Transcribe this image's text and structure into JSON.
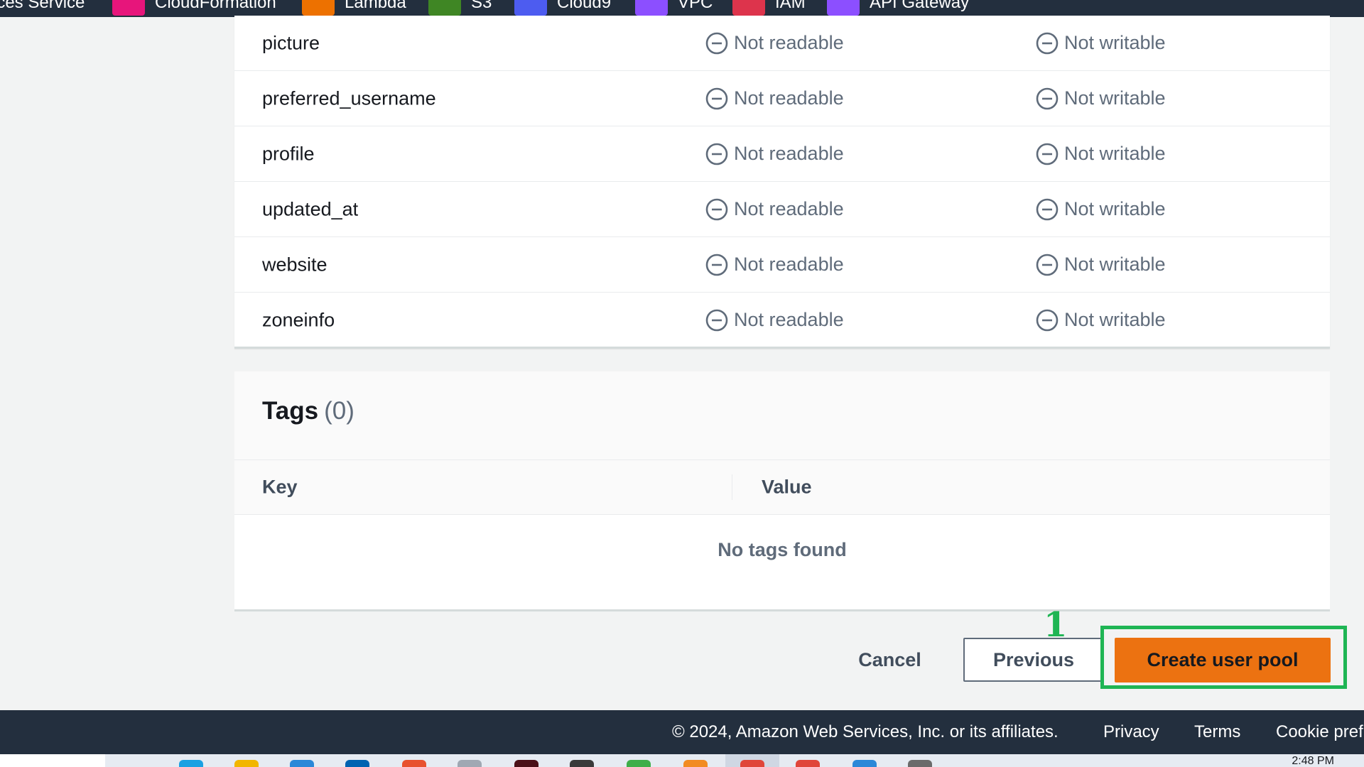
{
  "nav_services": [
    {
      "label": "ices Service",
      "color": "#232f3e"
    },
    {
      "label": "CloudFormation",
      "color": "#e7157b"
    },
    {
      "label": "Lambda",
      "color": "#ed7100"
    },
    {
      "label": "S3",
      "color": "#3f8624"
    },
    {
      "label": "Cloud9",
      "color": "#4d5cf0"
    },
    {
      "label": "VPC",
      "color": "#8c4fff"
    },
    {
      "label": "IAM",
      "color": "#dd344c"
    },
    {
      "label": "API Gateway",
      "color": "#8c4fff"
    }
  ],
  "attributes": [
    {
      "name": "picture",
      "read": "Not readable",
      "write": "Not writable"
    },
    {
      "name": "preferred_username",
      "read": "Not readable",
      "write": "Not writable"
    },
    {
      "name": "profile",
      "read": "Not readable",
      "write": "Not writable"
    },
    {
      "name": "updated_at",
      "read": "Not readable",
      "write": "Not writable"
    },
    {
      "name": "website",
      "read": "Not readable",
      "write": "Not writable"
    },
    {
      "name": "zoneinfo",
      "read": "Not readable",
      "write": "Not writable"
    }
  ],
  "tags": {
    "title": "Tags",
    "count": "(0)",
    "col_key": "Key",
    "col_value": "Value",
    "empty": "No tags found"
  },
  "actions": {
    "cancel": "Cancel",
    "previous": "Previous",
    "create": "Create user pool",
    "step_marker": "1",
    "highlight_color": "#1fb554",
    "primary_color": "#ec7211"
  },
  "footer": {
    "copyright": "© 2024, Amazon Web Services, Inc. or its affiliates.",
    "privacy": "Privacy",
    "terms": "Terms",
    "cookie": "Cookie pref"
  },
  "taskbar": {
    "time": "2:48 PM"
  }
}
